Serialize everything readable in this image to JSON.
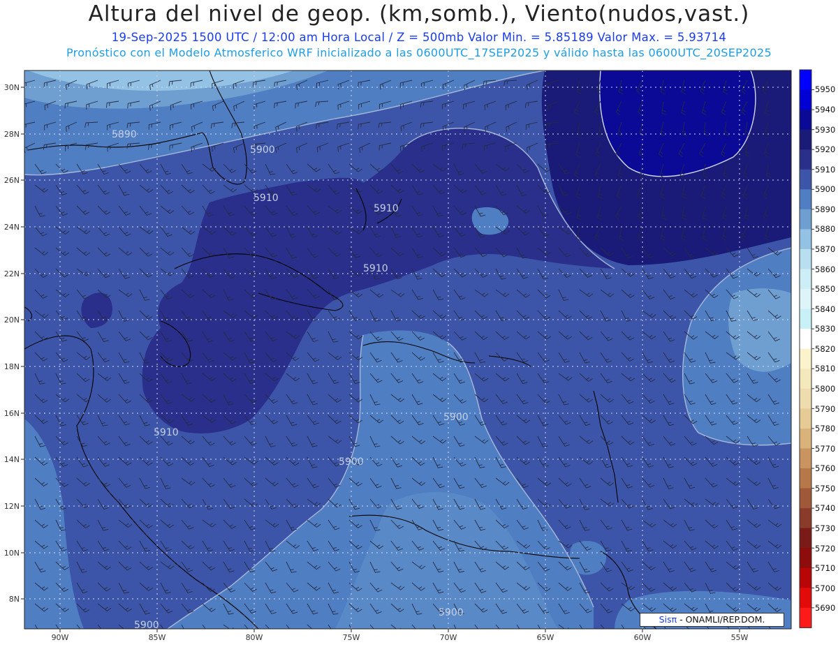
{
  "header": {
    "title": "Altura del nivel de geop. (km,somb.), Viento(nudos,vast.)",
    "subtitle1": "19-Sep-2025  1500 UTC / 12:00 am Hora Local / Z = 500mb    Valor Min. = 5.85189  Valor Max. = 5.93714",
    "subtitle2": "Pronóstico con el Modelo Atmosferico WRF inicializado a las 0600UTC_17SEP2025 y válido hasta las  0600UTC_20SEP2025"
  },
  "map": {
    "lon_labels": [
      "90W",
      "85W",
      "80W",
      "75W",
      "70W",
      "65W",
      "60W",
      "55W"
    ],
    "lat_labels": [
      "30N",
      "28N",
      "26N",
      "24N",
      "22N",
      "20N",
      "18N",
      "16N",
      "14N",
      "12N",
      "10N",
      "8N"
    ],
    "contour_labels": [
      "5890",
      "5900",
      "5910",
      "5910",
      "5910",
      "5910",
      "5900",
      "5900",
      "5900",
      "5900"
    ]
  },
  "colorbar": {
    "levels": [
      "5950",
      "5940",
      "5930",
      "5920",
      "5910",
      "5900",
      "5890",
      "5880",
      "5870",
      "5860",
      "5850",
      "5840",
      "5830",
      "5820",
      "5810",
      "5800",
      "5790",
      "5780",
      "5770",
      "5760",
      "5750",
      "5740",
      "5730",
      "5720",
      "5710",
      "5700",
      "5690"
    ],
    "colors": [
      "#0000ff",
      "#0000d4",
      "#0a0a96",
      "#1a1a78",
      "#2a2f8c",
      "#3c55a8",
      "#4f7ec2",
      "#6f9fd1",
      "#94c2e4",
      "#b8dff0",
      "#cdeef6",
      "#ddf4f9",
      "#c8f1f7",
      "#ffffff",
      "#fbf3cc",
      "#f4e8bd",
      "#eedcae",
      "#e6cc94",
      "#d9b37a",
      "#c99460",
      "#b77849",
      "#a05938",
      "#8a3b2a",
      "#7a1b18",
      "#8f0c0c",
      "#b80606",
      "#e30a0a",
      "#ff1a1a"
    ]
  },
  "credit": {
    "sis": "Sisπ",
    "org": "- ONAMLI/REP.DOM."
  }
}
